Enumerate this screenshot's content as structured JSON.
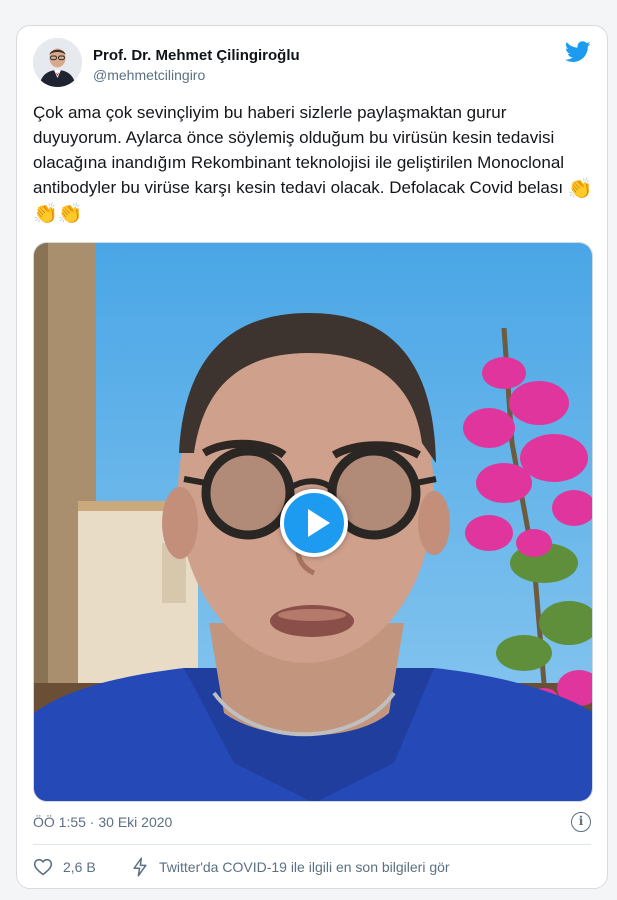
{
  "author": {
    "display_name": "Prof. Dr. Mehmet Çilingiroğlu",
    "handle": "@mehmetcilingiro"
  },
  "tweet": {
    "text": "Çok ama çok sevinçliyim bu haberi sizlerle paylaşmaktan gurur duyuyorum. Aylarca önce söylemiş olduğum bu virüsün kesin tedavisi olacağına inandığım Rekombinant teknolojisi ile geliştirilen Monoclonal antibodyler bu virüse karşı kesin tedavi olacak. Defolacak Covid belası",
    "emoji": "👏👏👏"
  },
  "meta": {
    "timestamp": "ÖÖ 1:55 · 30 Eki 2020"
  },
  "actions": {
    "like_count": "2,6 B",
    "covid_info_label": "Twitter'da COVID-19 ile ilgili en son bilgileri gör"
  },
  "icons": {
    "brand": "twitter-bird-icon",
    "play": "play-icon",
    "info": "info-icon",
    "like": "heart-icon",
    "covid": "lightning-icon"
  },
  "colors": {
    "twitter_blue": "#1d9bf0",
    "secondary_text": "#5b7083",
    "primary_text": "#0f1419"
  }
}
